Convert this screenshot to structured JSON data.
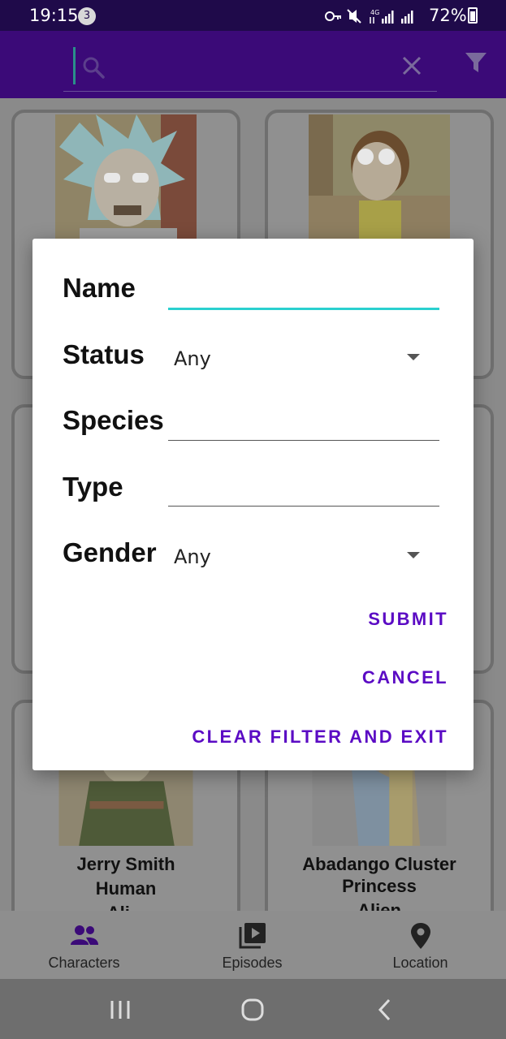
{
  "status_bar": {
    "time": "19:15",
    "notification_count": "3",
    "battery": "72%"
  },
  "app_bar": {
    "search_placeholder": ""
  },
  "cards": [
    {
      "name": "",
      "species": "",
      "status": ""
    },
    {
      "name": "",
      "species": "",
      "status": ""
    },
    {
      "name": "",
      "species": "",
      "status": ""
    },
    {
      "name": "",
      "species": "",
      "status": ""
    },
    {
      "name_line1": "Jerry Smith",
      "name_line2": "Human",
      "name_line3": "Ali..."
    },
    {
      "name_line1": "Abadango Cluster",
      "name_line2": "Princess",
      "name_line3": "Alien"
    }
  ],
  "filter_dialog": {
    "name_label": "Name",
    "name_value": "",
    "status_label": "Status",
    "status_value": "Any",
    "species_label": "Species",
    "species_value": "",
    "type_label": "Type",
    "type_value": "",
    "gender_label": "Gender",
    "gender_value": "Any",
    "submit": "SUBMIT",
    "cancel": "CANCEL",
    "clear": "CLEAR FILTER AND EXIT"
  },
  "bottom_nav": [
    {
      "label": "Characters",
      "icon": "people-icon",
      "active": true
    },
    {
      "label": "Episodes",
      "icon": "video-library-icon",
      "active": false
    },
    {
      "label": "Location",
      "icon": "location-pin-icon",
      "active": false
    }
  ],
  "colors": {
    "primary": "#3b0a78",
    "accent": "#5b0bc4",
    "focus_underline": "#2ad0cf",
    "scrim": "#8a8a8a"
  }
}
